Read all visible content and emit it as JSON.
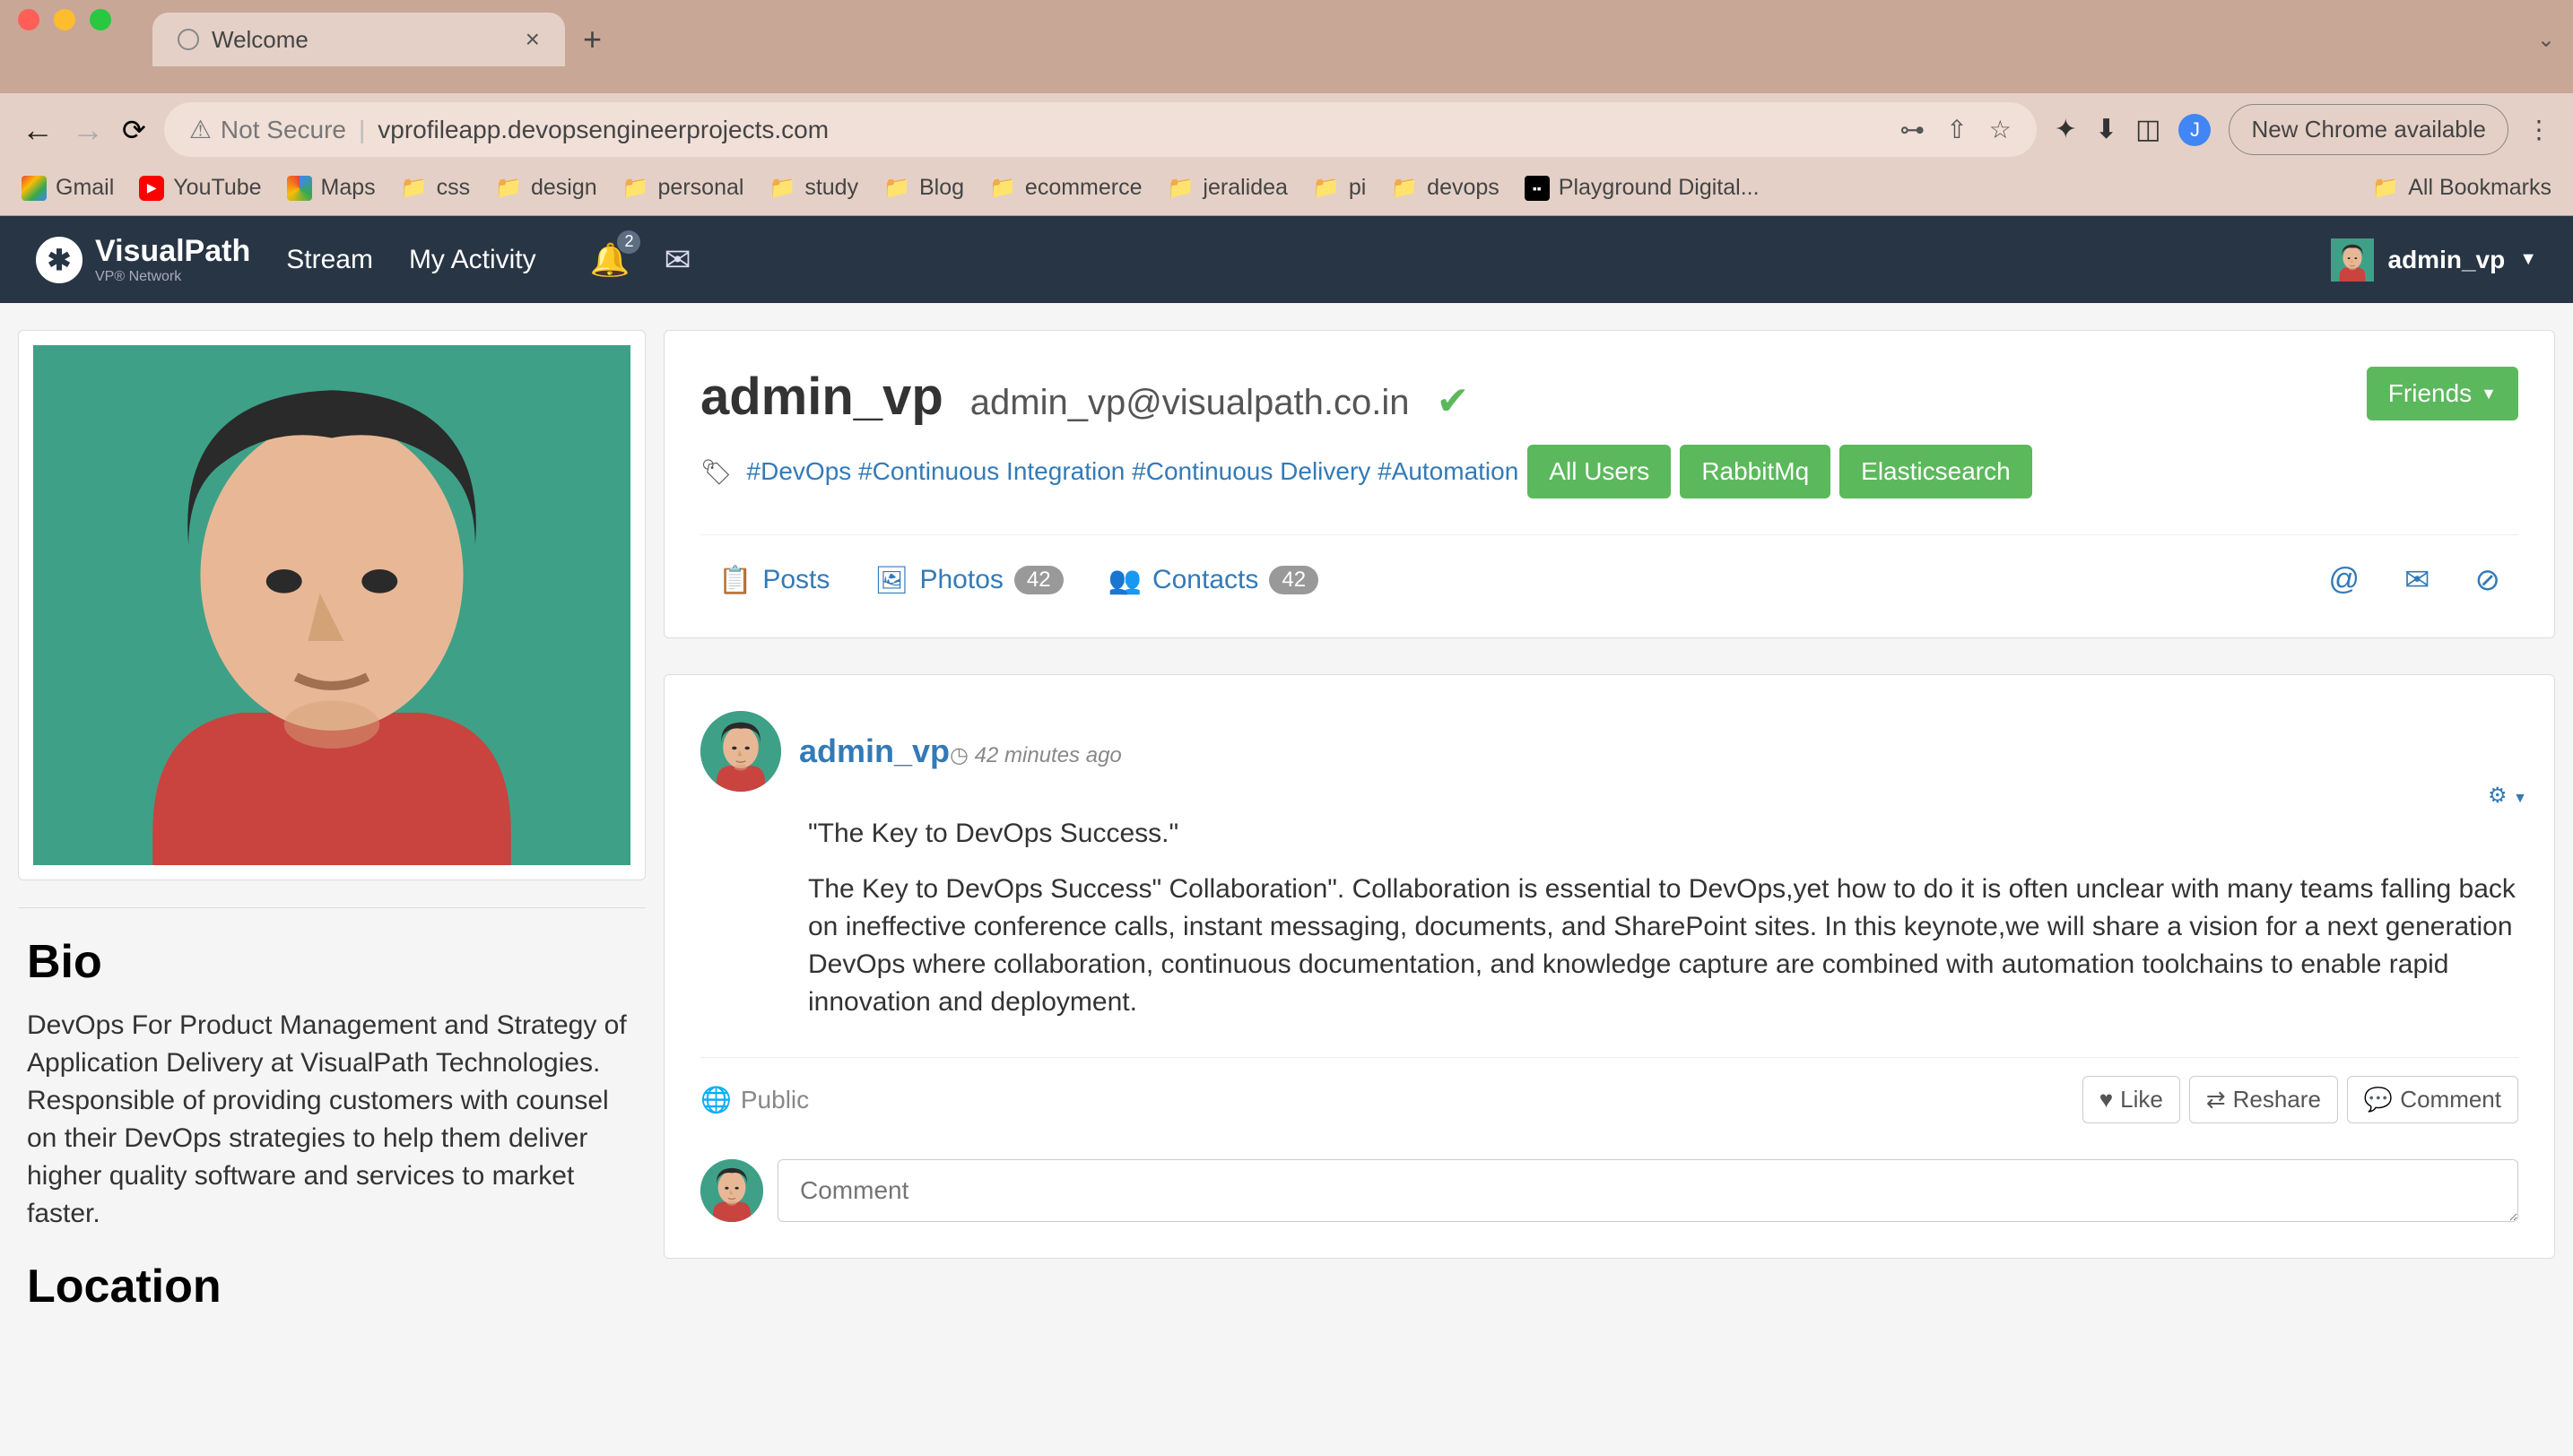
{
  "browser": {
    "tab_title": "Welcome",
    "not_secure_label": "Not Secure",
    "url": "vprofileapp.devopsengineerprojects.com",
    "chrome_update": "New Chrome available",
    "profile_initial": "J",
    "bookmarks": [
      {
        "label": "Gmail",
        "icon": "gmail"
      },
      {
        "label": "YouTube",
        "icon": "youtube"
      },
      {
        "label": "Maps",
        "icon": "maps"
      },
      {
        "label": "css",
        "icon": "folder"
      },
      {
        "label": "design",
        "icon": "folder"
      },
      {
        "label": "personal",
        "icon": "folder"
      },
      {
        "label": "study",
        "icon": "folder"
      },
      {
        "label": "Blog",
        "icon": "folder"
      },
      {
        "label": "ecommerce",
        "icon": "folder"
      },
      {
        "label": "jeralidea",
        "icon": "folder"
      },
      {
        "label": "pi",
        "icon": "folder"
      },
      {
        "label": "devops",
        "icon": "folder"
      },
      {
        "label": "Playground Digital...",
        "icon": "square"
      }
    ],
    "all_bookmarks": "All Bookmarks"
  },
  "header": {
    "brand": "VisualPath",
    "sub_brand": "VP® Network",
    "nav": {
      "stream": "Stream",
      "activity": "My Activity"
    },
    "notif_count": "2",
    "user": "admin_vp"
  },
  "sidebar": {
    "bio_heading": "Bio",
    "bio_text": "DevOps For Product Management and Strategy of Application Delivery at VisualPath Technologies. Responsible of providing customers with counsel on their DevOps strategies to help them deliver higher quality software and services to market faster.",
    "location_heading": "Location"
  },
  "profile": {
    "name": "admin_vp",
    "email": "admin_vp@visualpath.co.in",
    "tags": [
      "#DevOps",
      "#Continuous Integration",
      "#Continuous Delivery",
      "#Automation"
    ],
    "buttons": {
      "all_users": "All Users",
      "rabbitmq": "RabbitMq",
      "elasticsearch": "Elasticsearch",
      "friends": "Friends"
    },
    "tabs": {
      "posts": "Posts",
      "photos": "Photos",
      "photos_count": "42",
      "contacts": "Contacts",
      "contacts_count": "42"
    }
  },
  "post": {
    "author": "admin_vp",
    "time": "42 minutes ago",
    "title": "\"The Key to DevOps Success.\"",
    "body": "The Key to DevOps Success\" Collaboration\". Collaboration is essential to DevOps,yet how to do it is often unclear with many teams falling back on ineffective conference calls, instant messaging, documents, and SharePoint sites. In this keynote,we will share a vision for a next generation DevOps where collaboration, continuous documentation, and knowledge capture are combined with automation toolchains to enable rapid innovation and deployment.",
    "visibility": "Public",
    "actions": {
      "like": "Like",
      "reshare": "Reshare",
      "comment": "Comment"
    },
    "comment_placeholder": "Comment"
  }
}
